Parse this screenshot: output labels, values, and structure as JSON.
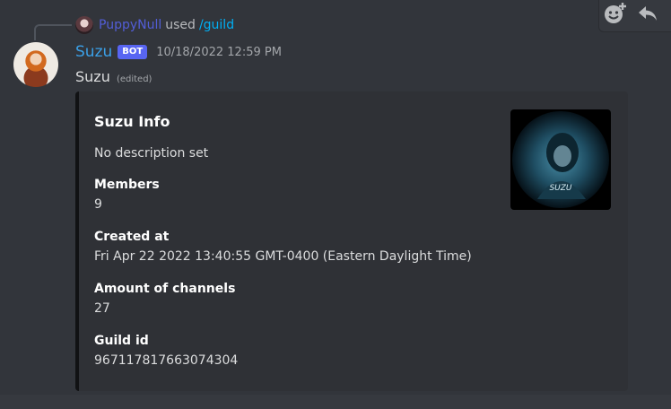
{
  "interaction": {
    "user": "PuppyNull",
    "used": "used",
    "command": "/guild"
  },
  "message": {
    "author": "Suzu",
    "bot_tag": "BOT",
    "timestamp": "10/18/2022 12:59 PM",
    "content": "Suzu",
    "edited": "(edited)"
  },
  "embed": {
    "title": "Suzu Info",
    "description": "No description set",
    "fields": [
      {
        "name": "Members",
        "value": "9"
      },
      {
        "name": "Created at",
        "value": "Fri Apr 22 2022 13:40:55 GMT-0400 (Eastern Daylight Time)"
      },
      {
        "name": "Amount of channels",
        "value": "27"
      },
      {
        "name": "Guild id",
        "value": "967117817663074304"
      }
    ],
    "thumbnail_text": "SUZU"
  },
  "toolbar": {
    "icons": [
      "add-reaction-icon",
      "reply-icon"
    ]
  },
  "colors": {
    "background": "#36393f",
    "embed_background": "#2f3136",
    "embed_border": "#111214",
    "username": "#3ba0e7",
    "bot_tag": "#5865f2",
    "command": "#00aff4"
  }
}
